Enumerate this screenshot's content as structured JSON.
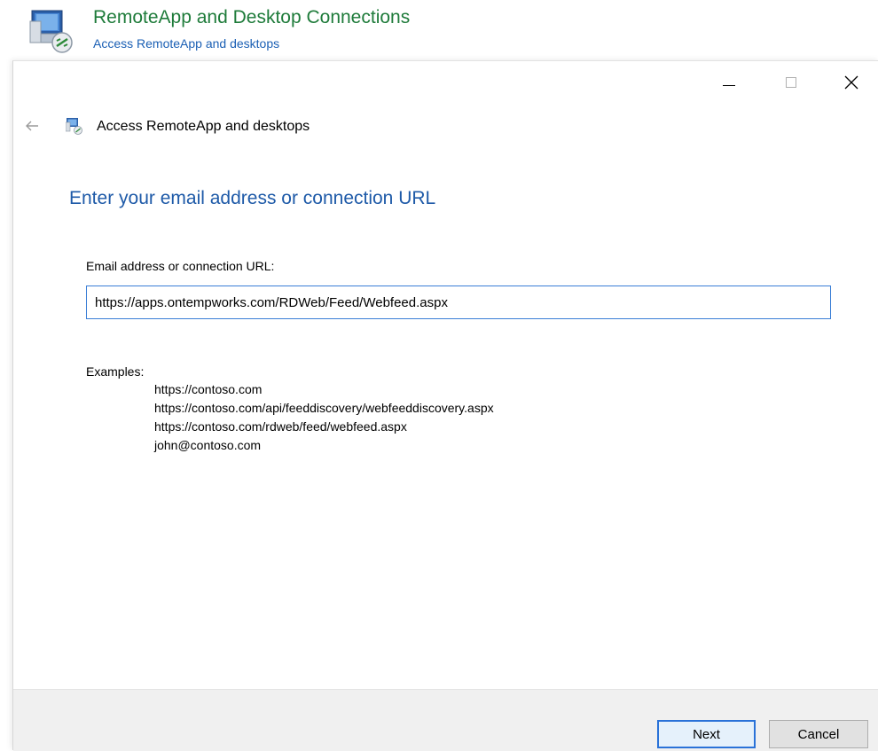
{
  "control_panel": {
    "title": "RemoteApp and Desktop Connections",
    "subtitle": "Access RemoteApp and desktops",
    "icon": "remote-desktop-icon"
  },
  "window": {
    "controls": {
      "minimize": "minimize-icon",
      "maximize": "maximize-icon",
      "close": "close-icon"
    }
  },
  "nav": {
    "back": "back-arrow-icon",
    "title": "Access RemoteApp and desktops"
  },
  "page": {
    "heading": "Enter your email address or connection URL",
    "field_label": "Email address or connection URL:",
    "field_value": "https://apps.ontempworks.com/RDWeb/Feed/Webfeed.aspx",
    "examples_label": "Examples:",
    "examples": [
      "https://contoso.com",
      "https://contoso.com/api/feeddiscovery/webfeeddiscovery.aspx",
      "https://contoso.com/rdweb/feed/webfeed.aspx",
      "john@contoso.com"
    ]
  },
  "footer": {
    "next_label": "Next",
    "cancel_label": "Cancel"
  },
  "colors": {
    "title_green": "#1e7b3a",
    "link_blue": "#1a5fb4",
    "heading_blue": "#1e5aa8",
    "focus_blue": "#3a7ed6",
    "footer_bg": "#f0f0f0"
  }
}
